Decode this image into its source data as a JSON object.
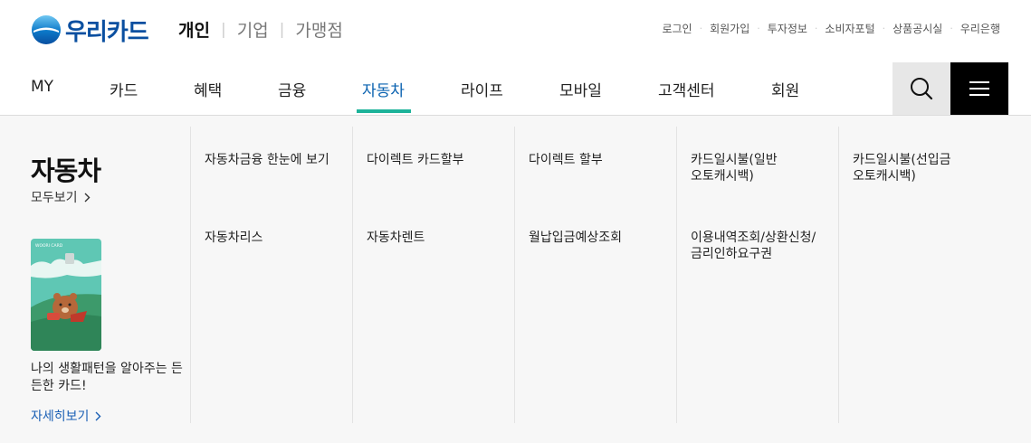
{
  "header": {
    "logo_text": "우리카드",
    "segments": [
      {
        "label": "개인",
        "active": true
      },
      {
        "label": "기업",
        "active": false
      },
      {
        "label": "가맹점",
        "active": false
      }
    ],
    "util_links": [
      "로그인",
      "회원가입",
      "투자정보",
      "소비자포털",
      "상품공시실",
      "우리은행"
    ]
  },
  "gnb": {
    "items": [
      "MY",
      "카드",
      "혜택",
      "금융",
      "자동차",
      "라이프",
      "모바일",
      "고객센터",
      "회원"
    ],
    "active_item": "자동차",
    "accent_color": "#1db39a"
  },
  "panel": {
    "title": "자동차",
    "view_all": "모두보기",
    "promo_text": "나의 생활패턴을 알아주는 든든한 카드!",
    "detail_link": "자세히보기",
    "menu": [
      "자동차금융 한눈에 보기",
      "다이렉트 카드할부",
      "다이렉트 할부",
      "카드일시불(일반 오토캐시백)",
      "카드일시불(선입금 오토캐시백)",
      "자동차리스",
      "자동차렌트",
      "월납입금예상조회",
      "이용내역조회/상환신청/금리인하요구권"
    ]
  }
}
